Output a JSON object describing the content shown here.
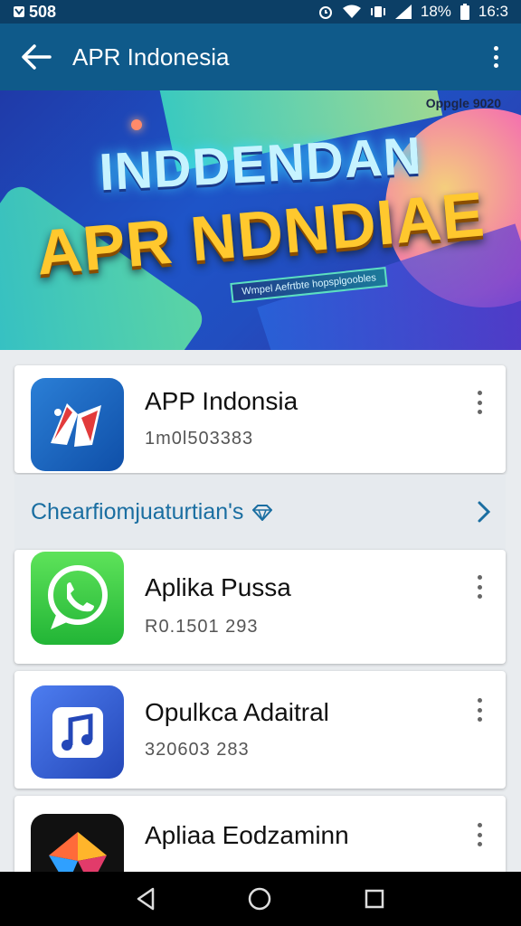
{
  "status_bar": {
    "left_text": "508",
    "battery": "18%",
    "time": "16:3"
  },
  "app_bar": {
    "title": "APR Indonesia"
  },
  "banner": {
    "tag": "Oppgle 9020",
    "title_line1": "INDDENDAN",
    "title_line2": "APR NDNDIAE",
    "subtitle": "Wmpel Aefrtbte hopsplgoobles"
  },
  "items": [
    {
      "name": "APP Indonsia",
      "sub": "1m0l503383",
      "icon": "app-logo-icon"
    },
    {
      "name": "Aplika Pussa",
      "sub": "R0.1501 293",
      "icon": "whatsapp-icon"
    },
    {
      "name": "Opulkca Adaitral",
      "sub": "320603 283",
      "icon": "music-note-icon"
    },
    {
      "name": "Apliaa Eodzaminn",
      "sub": "",
      "icon": "colorful-logo-icon"
    }
  ],
  "section": {
    "title": "Chearfiomjuaturtian's"
  },
  "colors": {
    "status_bar": "#0c3f66",
    "app_bar": "#0f5a8a",
    "accent": "#1a6ea1"
  }
}
